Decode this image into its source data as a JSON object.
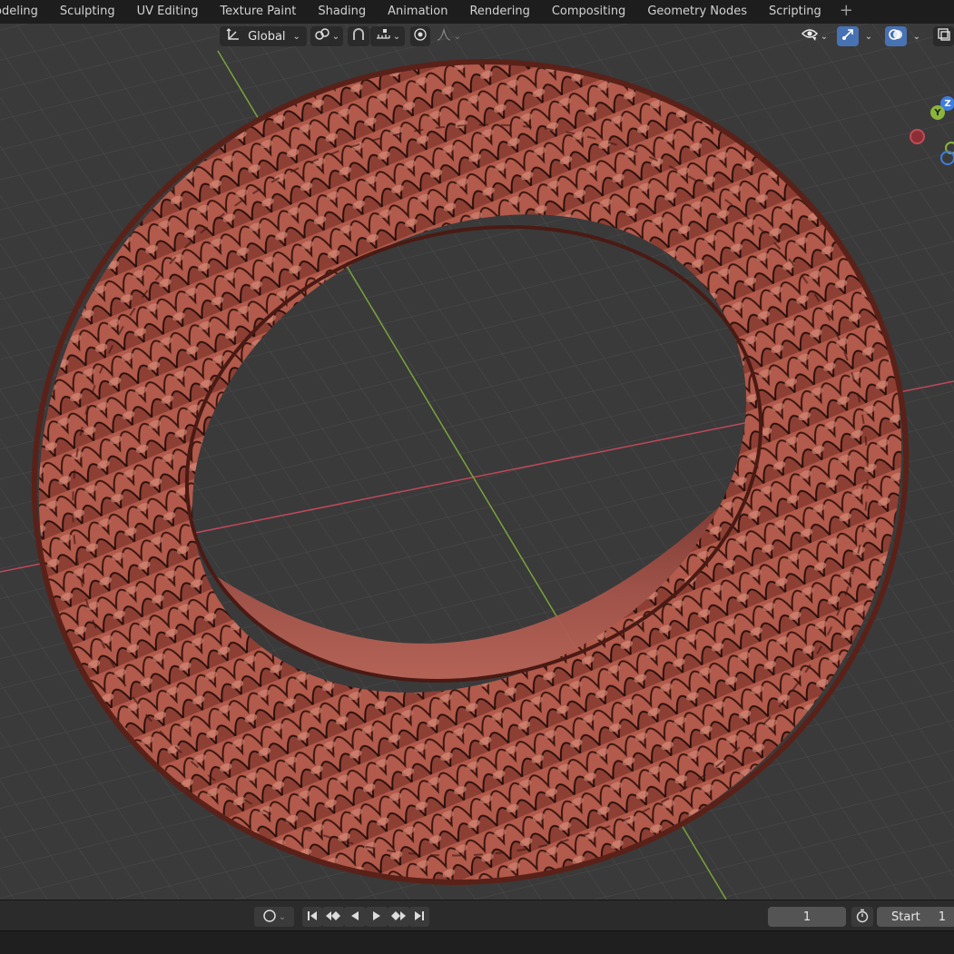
{
  "workspace_tabs": [
    "odeling",
    "Sculpting",
    "UV Editing",
    "Texture Paint",
    "Shading",
    "Animation",
    "Rendering",
    "Compositing",
    "Geometry Nodes",
    "Scripting"
  ],
  "add_tab_label": "+",
  "header": {
    "orientation_label": "Global"
  },
  "gizmo": {
    "y_label": "Y",
    "z_label": "Z"
  },
  "timeline": {
    "current_frame": "1",
    "start_label": "Start",
    "start_value": "1"
  },
  "colors": {
    "viewport_bg": "#393939",
    "grid": "#4a4a4a",
    "axis_x": "#c0485a",
    "axis_y": "#7aa33a",
    "ring_surface": "#b5584a",
    "accent": "#4772b3"
  }
}
